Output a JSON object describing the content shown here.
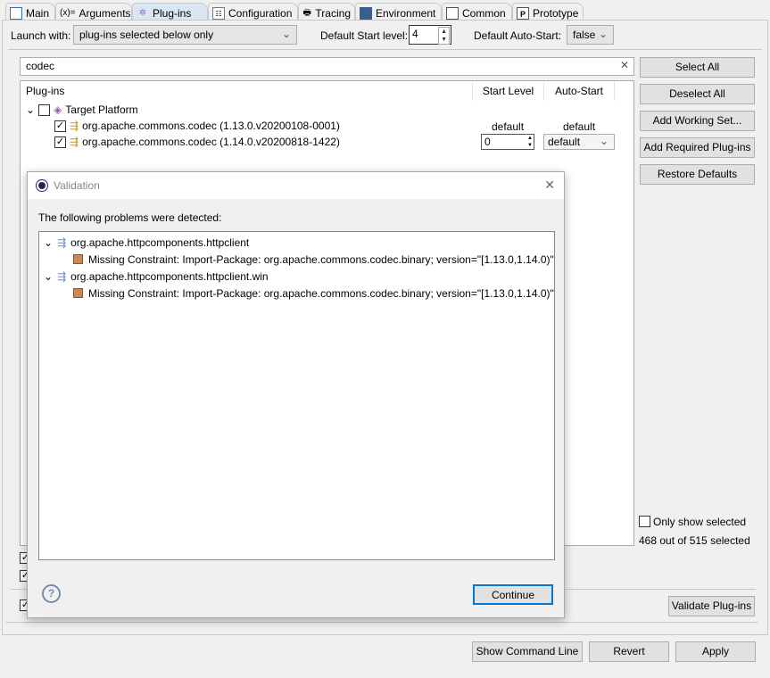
{
  "tabs": [
    {
      "label": "Main",
      "icon": "main-icon"
    },
    {
      "label": "Arguments",
      "icon": "x-equals-icon"
    },
    {
      "label": "Plug-ins",
      "icon": "plugin-icon"
    },
    {
      "label": "Configuration",
      "icon": "config-icon"
    },
    {
      "label": "Tracing",
      "icon": "tracing-icon"
    },
    {
      "label": "Environment",
      "icon": "environment-icon"
    },
    {
      "label": "Common",
      "icon": "common-icon"
    },
    {
      "label": "Prototype",
      "icon": "prototype-icon"
    }
  ],
  "args_icon_text": "(x)=",
  "proto_icon_text": "P",
  "launch": {
    "label": "Launch with:",
    "value": "plug-ins selected below only",
    "start_level_label": "Default Start level:",
    "start_level": "4",
    "auto_start_label": "Default Auto-Start:",
    "auto_start": "false"
  },
  "filter": {
    "value": "codec"
  },
  "table": {
    "headers": [
      "Plug-ins",
      "Start Level",
      "Auto-Start"
    ],
    "root": "Target Platform",
    "rows": [
      {
        "name": "org.apache.commons.codec (1.13.0.v20200108-0001)",
        "start": "default",
        "auto": "default",
        "checked": true
      },
      {
        "name": "org.apache.commons.codec (1.14.0.v20200818-1422)",
        "start": "0",
        "auto": "default",
        "checked": true
      }
    ]
  },
  "side_buttons": [
    "Select All",
    "Deselect All",
    "Add Working Set...",
    "Add Required Plug-ins",
    "Restore Defaults"
  ],
  "only_show_selected": "Only show selected",
  "selected_count": "468 out of 515 selected",
  "validate_button": "Validate Plug-ins",
  "bottom_buttons": [
    "Show Command Line",
    "Revert",
    "Apply"
  ],
  "dialog": {
    "title": "Validation",
    "message": "The following problems were detected:",
    "problems": [
      {
        "bundle": "org.apache.httpcomponents.httpclient",
        "detail": "Missing Constraint: Import-Package: org.apache.commons.codec.binary; version=\"[1.13.0,1.14.0)\""
      },
      {
        "bundle": "org.apache.httpcomponents.httpclient.win",
        "detail": "Missing Constraint: Import-Package: org.apache.commons.codec.binary; version=\"[1.13.0,1.14.0)\""
      }
    ],
    "continue": "Continue"
  }
}
